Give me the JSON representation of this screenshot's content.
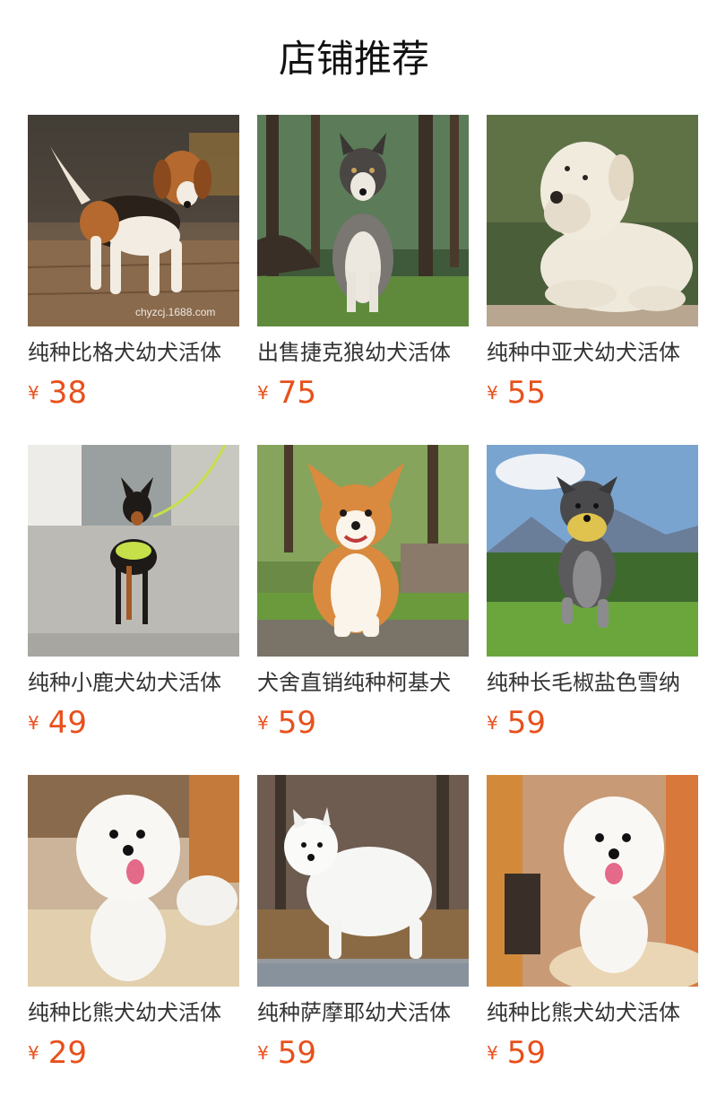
{
  "page_title": "店铺推荐",
  "currency_symbol": "¥",
  "products": [
    {
      "name": "纯种比格犬幼犬活体",
      "price": "38",
      "image": "beagle-photo",
      "watermark": "chyzcj.1688.com"
    },
    {
      "name": "出售捷克狼幼犬活体",
      "price": "75",
      "image": "wolfdog-photo"
    },
    {
      "name": "纯种中亚犬幼犬活体",
      "price": "55",
      "image": "central-asian-shepherd-photo"
    },
    {
      "name": "纯种小鹿犬幼犬活体",
      "price": "49",
      "image": "min-pin-photo"
    },
    {
      "name": "犬舍直销纯种柯基犬",
      "price": "59",
      "image": "corgi-photo"
    },
    {
      "name": "纯种长毛椒盐色雪纳",
      "price": "59",
      "image": "schnauzer-photo"
    },
    {
      "name": "纯种比熊犬幼犬活体",
      "price": "29",
      "image": "bichon-photo"
    },
    {
      "name": "纯种萨摩耶幼犬活体",
      "price": "59",
      "image": "samoyed-photo"
    },
    {
      "name": "纯种比熊犬幼犬活体",
      "price": "59",
      "image": "bichon-photo-2"
    }
  ]
}
